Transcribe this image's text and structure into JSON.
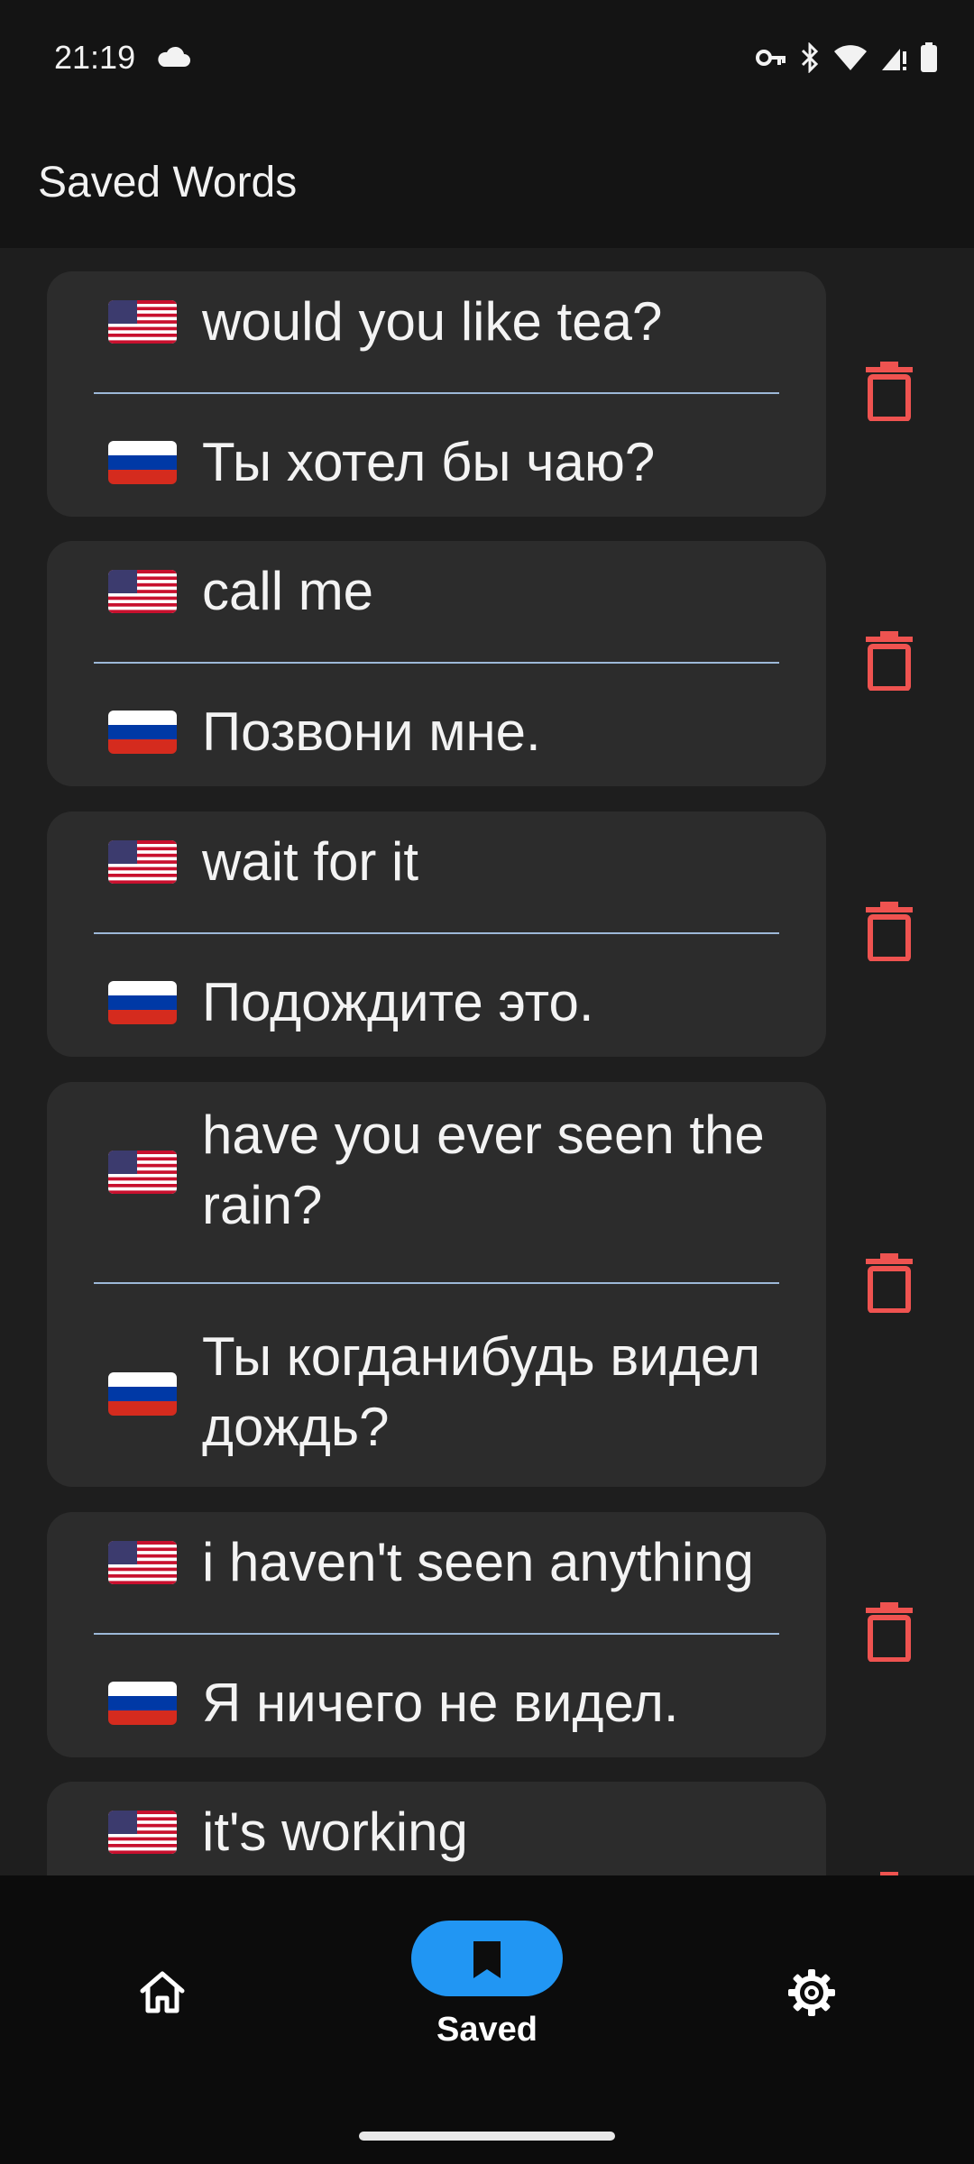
{
  "status_bar": {
    "time": "21:19",
    "icons": [
      "cloud-icon",
      "vpn-key-icon",
      "bluetooth-icon",
      "wifi-icon",
      "signal-icon",
      "battery-icon"
    ]
  },
  "app_bar": {
    "title": "Saved Words"
  },
  "colors": {
    "background": "#1e1e1e",
    "card": "#2c2c2c",
    "divider": "#9db8d8",
    "delete": "#ef5350",
    "accent": "#2196f3"
  },
  "saved_items": [
    {
      "source_flag": "us-flag-icon",
      "source": "would you like tea?",
      "target_flag": "ru-flag-icon",
      "target": "Ты хотел бы чаю?"
    },
    {
      "source_flag": "us-flag-icon",
      "source": "call me",
      "target_flag": "ru-flag-icon",
      "target": "Позвони мне."
    },
    {
      "source_flag": "us-flag-icon",
      "source": "wait for it",
      "target_flag": "ru-flag-icon",
      "target": "Подождите это."
    },
    {
      "source_flag": "us-flag-icon",
      "source": "have you ever seen the rain?",
      "target_flag": "ru-flag-icon",
      "target": "Ты когданибудь видел дождь?"
    },
    {
      "source_flag": "us-flag-icon",
      "source": "i haven't seen anything",
      "target_flag": "ru-flag-icon",
      "target": "Я ничего не видел."
    },
    {
      "source_flag": "us-flag-icon",
      "source": "it's working",
      "target_flag": "ru-flag-icon",
      "target": ""
    }
  ],
  "bottom_nav": {
    "items": [
      {
        "icon": "home-icon",
        "label": ""
      },
      {
        "icon": "bookmark-icon",
        "label": "Saved",
        "selected": true
      },
      {
        "icon": "gear-icon",
        "label": ""
      }
    ]
  }
}
